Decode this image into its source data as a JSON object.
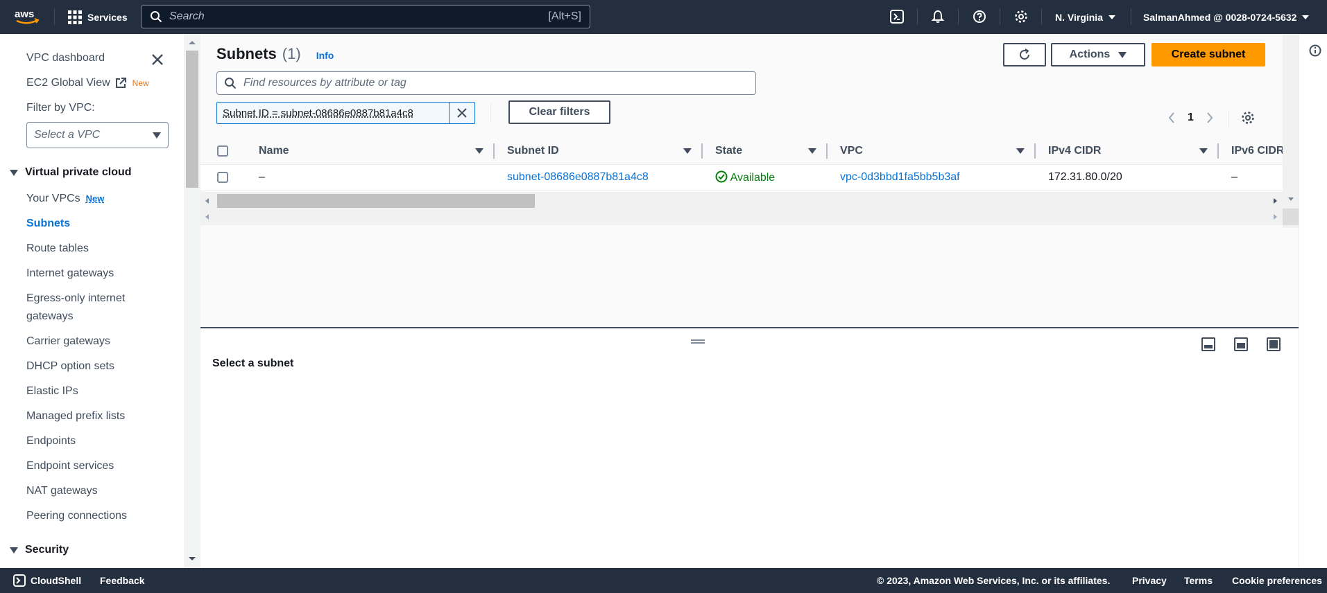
{
  "topnav": {
    "logo_text": "aws",
    "services_label": "Services",
    "search_placeholder": "Search",
    "search_shortcut": "[Alt+S]",
    "region": "N. Virginia",
    "account": "SalmanAhmed @ 0028-0724-5632",
    "icons": [
      "cloudshell-icon",
      "bell-icon",
      "help-icon",
      "settings-icon"
    ]
  },
  "sidebar": {
    "dashboard": "VPC dashboard",
    "ec2_global": "EC2 Global View",
    "ec2_global_badge": "New",
    "filter_label": "Filter by VPC:",
    "vpc_select_placeholder": "Select a VPC",
    "section_vpc": "Virtual private cloud",
    "items": [
      {
        "label": "Your VPCs",
        "badge": "New"
      },
      {
        "label": "Subnets",
        "active": true
      },
      {
        "label": "Route tables"
      },
      {
        "label": "Internet gateways"
      },
      {
        "label": "Egress-only internet gateways"
      },
      {
        "label": "Carrier gateways"
      },
      {
        "label": "DHCP option sets"
      },
      {
        "label": "Elastic IPs"
      },
      {
        "label": "Managed prefix lists"
      },
      {
        "label": "Endpoints"
      },
      {
        "label": "Endpoint services"
      },
      {
        "label": "NAT gateways"
      },
      {
        "label": "Peering connections"
      }
    ],
    "section_security": "Security"
  },
  "main": {
    "title": "Subnets",
    "count": "(1)",
    "info": "Info",
    "actions_label": "Actions",
    "create_label": "Create subnet",
    "filter_placeholder": "Find resources by attribute or tag",
    "filter_token": "Subnet ID = subnet-08686e0887b81a4c8",
    "clear_filters": "Clear filters",
    "page": "1",
    "columns": [
      "Name",
      "Subnet ID",
      "State",
      "VPC",
      "IPv4 CIDR",
      "IPv6 CIDR"
    ],
    "rows": [
      {
        "name": "–",
        "subnet_id": "subnet-08686e0887b81a4c8",
        "state": "Available",
        "vpc": "vpc-0d3bbd1fa5bb5b3af",
        "ipv4": "172.31.80.0/20",
        "ipv6": "–"
      }
    ],
    "detail_label": "Select a subnet"
  },
  "footer": {
    "cloudshell": "CloudShell",
    "feedback": "Feedback",
    "copyright": "© 2023, Amazon Web Services, Inc. or its affiliates.",
    "privacy": "Privacy",
    "terms": "Terms",
    "cookies": "Cookie preferences"
  },
  "colors": {
    "nav_bg": "#232f3e",
    "accent": "#0972d3",
    "primary_button": "#ff9900",
    "success": "#037f0c",
    "new_badge": "#ec7211"
  }
}
